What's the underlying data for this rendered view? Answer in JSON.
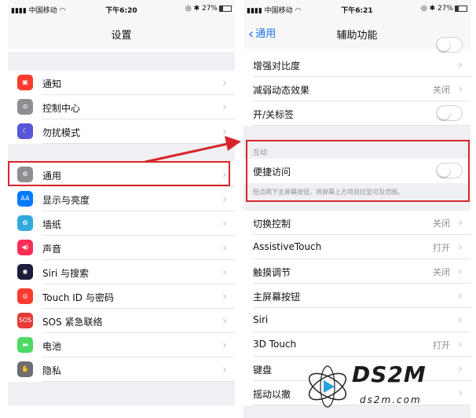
{
  "left": {
    "status": {
      "carrier": "中国移动",
      "time": "下午6:20",
      "battery": "27%"
    },
    "title": "设置",
    "rows": [
      {
        "name": "notifications",
        "label": "通知",
        "icon": "notification-icon",
        "color": "#ff3b30",
        "glyph": "▣"
      },
      {
        "name": "control-center",
        "label": "控制中心",
        "icon": "control-center-icon",
        "color": "#8e8e93",
        "glyph": "⊜"
      },
      {
        "name": "do-not-disturb",
        "label": "勿扰模式",
        "icon": "moon-icon",
        "color": "#5856d6",
        "glyph": "☾"
      },
      {
        "name": "general",
        "label": "通用",
        "icon": "gear-icon",
        "color": "#8e8e93",
        "glyph": "⚙"
      },
      {
        "name": "display",
        "label": "显示与亮度",
        "icon": "display-icon",
        "color": "#007aff",
        "glyph": "AA"
      },
      {
        "name": "wallpaper",
        "label": "墙纸",
        "icon": "wallpaper-icon",
        "color": "#34aadc",
        "glyph": "✿"
      },
      {
        "name": "sounds",
        "label": "声音",
        "icon": "speaker-icon",
        "color": "#ff2d55",
        "glyph": "◀)"
      },
      {
        "name": "siri",
        "label": "Siri 与搜索",
        "icon": "siri-icon",
        "color": "#1c1c3c",
        "glyph": "◉"
      },
      {
        "name": "touch-id",
        "label": "Touch ID 与密码",
        "icon": "fingerprint-icon",
        "color": "#ff3b30",
        "glyph": "◎"
      },
      {
        "name": "sos",
        "label": "SOS 紧急联络",
        "icon": "sos-icon",
        "color": "#e53935",
        "glyph": "SOS"
      },
      {
        "name": "battery",
        "label": "电池",
        "icon": "battery-icon",
        "color": "#4cd964",
        "glyph": "▬"
      },
      {
        "name": "privacy",
        "label": "隐私",
        "icon": "hand-icon",
        "color": "#6d6d72",
        "glyph": "✋"
      }
    ]
  },
  "right": {
    "status": {
      "carrier": "中国移动",
      "time": "下午6:21",
      "battery": "27%"
    },
    "back_label": "通用",
    "title": "辅助功能",
    "rows_top": [
      {
        "name": "increase-contrast",
        "label": "增强对比度",
        "value": ""
      },
      {
        "name": "reduce-motion",
        "label": "减弱动态效果",
        "value": "关闭"
      },
      {
        "name": "on-off-labels",
        "label": "开/关标签",
        "value": ""
      }
    ],
    "interaction_header": "互动",
    "reachability": {
      "label": "便捷访问",
      "footer": "轻点两下主屏幕按钮，将屏幕上方项目拉至可及范围。"
    },
    "rows_bottom": [
      {
        "name": "switch-control",
        "label": "切换控制",
        "value": "关闭"
      },
      {
        "name": "assistive-touch",
        "label": "AssistiveTouch",
        "value": "打开"
      },
      {
        "name": "touch-accommodations",
        "label": "触摸调节",
        "value": "关闭"
      },
      {
        "name": "home-button",
        "label": "主屏幕按钮",
        "value": ""
      },
      {
        "name": "siri",
        "label": "Siri",
        "value": ""
      },
      {
        "name": "3d-touch",
        "label": "3D Touch",
        "value": "打开"
      },
      {
        "name": "keyboard",
        "label": "键盘",
        "value": ""
      },
      {
        "name": "shake-to-undo",
        "label": "摇动以撤",
        "value": ""
      }
    ]
  },
  "watermark": {
    "brand": "DS2M",
    "domain": "ds2m.com"
  },
  "colors": {
    "highlight": "#d6262b",
    "link": "#1a73e8"
  }
}
